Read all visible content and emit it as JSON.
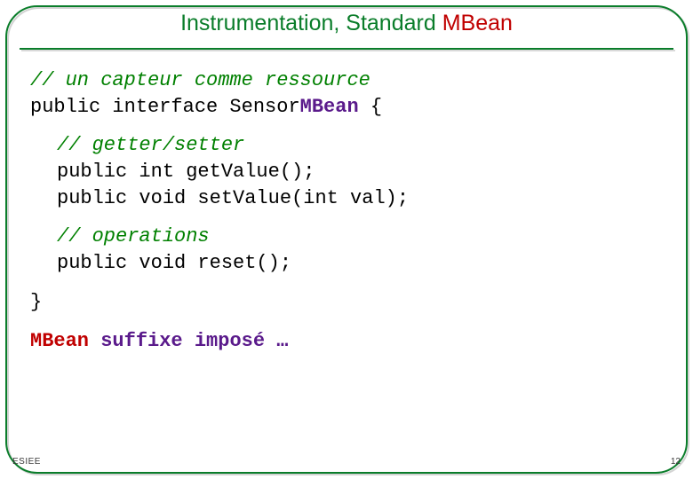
{
  "title": {
    "prefix": "Instrumentation, ",
    "standard": "Standard ",
    "mbean": "MBean"
  },
  "code": {
    "c1": "// un capteur comme ressource",
    "l2a": "public interface Sensor",
    "l2b": "MBean",
    "l2c": " {",
    "c2": "// getter/setter",
    "l3": "public int getValue();",
    "l4": "public void setValue(int val);",
    "c3": "// operations",
    "l5": "public void reset();",
    "brace": "}",
    "note_a": "MBean",
    "note_b": " suffixe imposé …"
  },
  "footer": {
    "esiee": "ESIEE",
    "page": "12"
  }
}
